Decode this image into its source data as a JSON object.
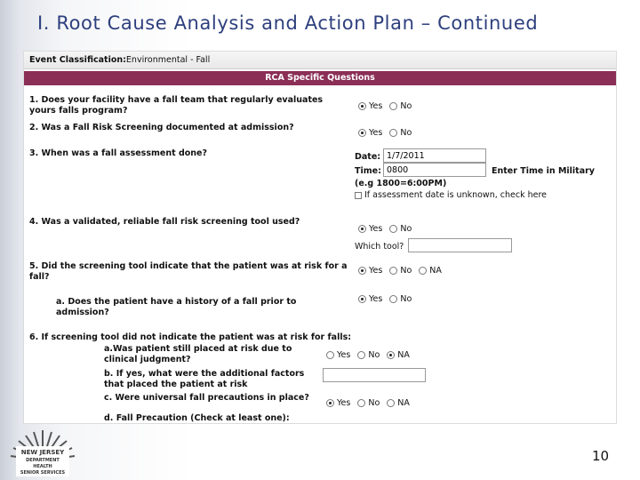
{
  "slide": {
    "title": "I.  Root Cause Analysis and Action Plan – Continued",
    "page_number": "10"
  },
  "form": {
    "event_label": "Event Classification:",
    "event_value": "Environmental - Fall",
    "section_header": "RCA Specific Questions",
    "q1": {
      "text": "1. Does your facility have a fall team that regularly evaluates yours falls program?",
      "options": [
        "Yes",
        "No"
      ],
      "selected": "Yes"
    },
    "q2": {
      "text": "2. Was a Fall Risk Screening documented at admission?",
      "options": [
        "Yes",
        "No"
      ],
      "selected": "Yes"
    },
    "q3": {
      "text": "3. When was a fall assessment done?",
      "date_label": "Date:",
      "date_value": "1/7/2011",
      "time_label": "Time:",
      "time_value": "0800",
      "time_note": "Enter Time in Military",
      "time_example": "(e.g 1800=6:00PM)",
      "unknown_label": "If assessment date is unknown, check here"
    },
    "q4": {
      "text": "4. Was a validated, reliable fall risk screening tool used?",
      "options": [
        "Yes",
        "No"
      ],
      "selected": "Yes",
      "which_tool_label": "Which tool?"
    },
    "q5": {
      "text": "5. Did the screening tool indicate that the patient was at risk for a fall?",
      "options": [
        "Yes",
        "No",
        "NA"
      ],
      "selected": "Yes"
    },
    "q5a": {
      "text": "a. Does the patient have a history of a fall prior to admission?",
      "options": [
        "Yes",
        "No"
      ],
      "selected": "Yes"
    },
    "q6": {
      "text": "6. If screening tool did not indicate the patient was at risk for falls:",
      "a": {
        "text": "a.Was patient still placed at risk due to clinical judgment?",
        "options": [
          "Yes",
          "No",
          "NA"
        ],
        "selected": "NA"
      },
      "b": {
        "text": "b. If yes, what were the additional factors that placed the patient at risk"
      },
      "c": {
        "text": "c. Were universal fall precautions in place?",
        "options": [
          "Yes",
          "No",
          "NA"
        ],
        "selected": "Yes"
      },
      "d": {
        "text": "d. Fall Precaution (Check at least one):"
      }
    }
  },
  "logo": {
    "line1": "NEW JERSEY",
    "line2": "DEPARTMENT",
    "line3": "HEALTH",
    "line4": "SENIOR SERVICES"
  },
  "colors": {
    "title": "#2d3f7d",
    "header_bar": "#8b2f57"
  }
}
